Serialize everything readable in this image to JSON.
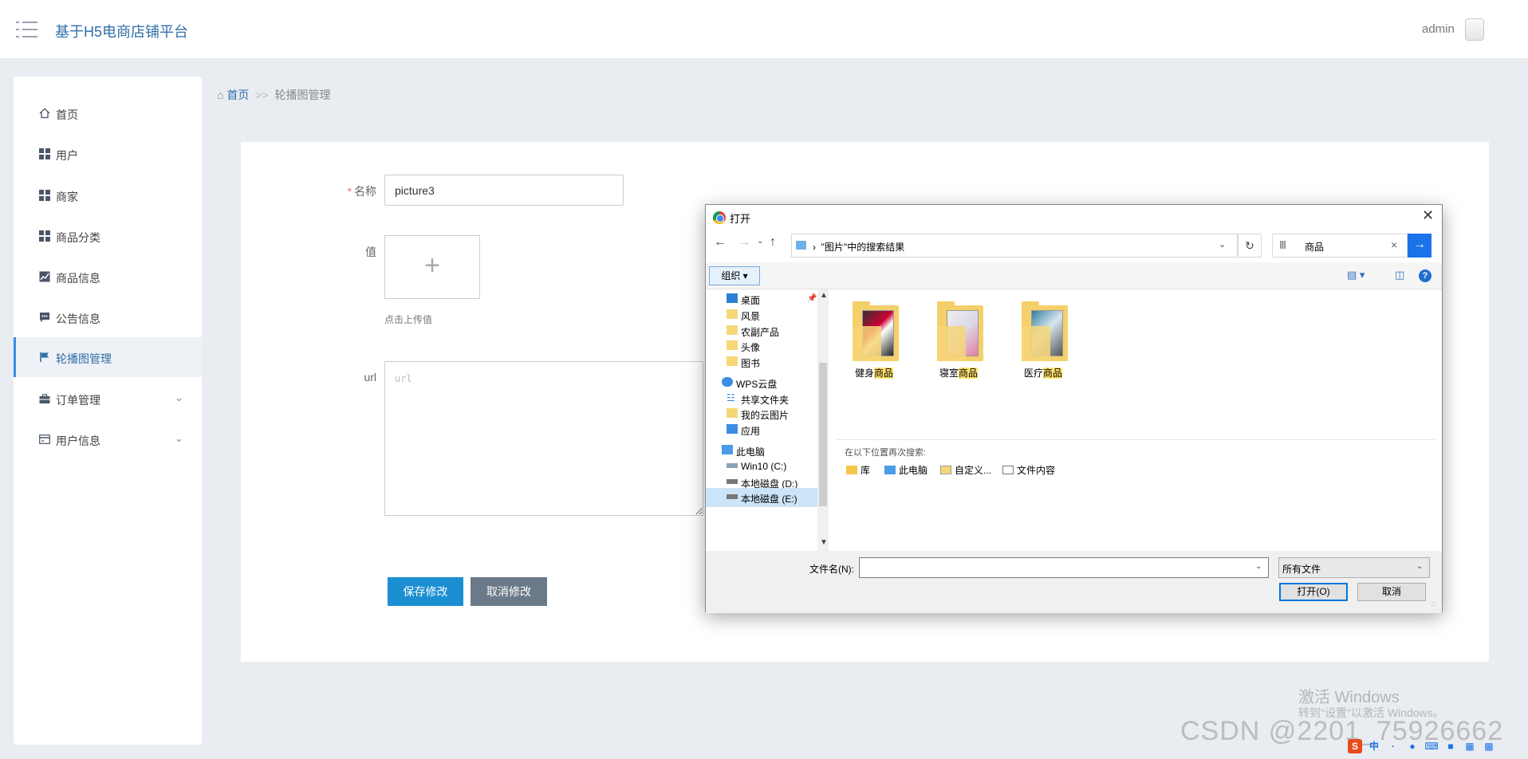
{
  "header": {
    "app_title": "基于H5电商店铺平台",
    "user_name": "admin"
  },
  "sidebar": {
    "items": [
      {
        "label": "首页"
      },
      {
        "label": "用户"
      },
      {
        "label": "商家"
      },
      {
        "label": "商品分类"
      },
      {
        "label": "商品信息"
      },
      {
        "label": "公告信息"
      },
      {
        "label": "轮播图管理",
        "active": true
      },
      {
        "label": "订单管理",
        "expandable": true
      },
      {
        "label": "用户信息",
        "expandable": true
      }
    ]
  },
  "breadcrumb": {
    "home": "首页",
    "separator": ">>",
    "current": "轮播图管理"
  },
  "form": {
    "name_label": "名称",
    "required_mark": "*",
    "name_value": "picture3",
    "value_label": "值",
    "upload_plus": "+",
    "upload_hint": "点击上传值",
    "url_label": "url",
    "url_placeholder": "url",
    "save_label": "保存修改",
    "cancel_label": "取消修改"
  },
  "watermarks": {
    "activate_title": "激活 Windows",
    "activate_sub": "转到\"设置\"以激活 Windows。",
    "csdn": "CSDN @2201_75926662"
  },
  "dialog": {
    "title": "打开",
    "address": "\"图片\"中的搜索结果",
    "search_query": "商品",
    "organize_label": "组织 ▾",
    "tree": [
      {
        "label": "桌面",
        "icon": "desktop-icon"
      },
      {
        "label": "风景",
        "icon": "folder-icon"
      },
      {
        "label": "农副产品",
        "icon": "folder-icon"
      },
      {
        "label": "头像",
        "icon": "folder-icon"
      },
      {
        "label": "图书",
        "icon": "folder-icon"
      },
      {
        "label": "WPS云盘",
        "icon": "cloud-icon"
      },
      {
        "label": "共享文件夹",
        "icon": "share-icon"
      },
      {
        "label": "我的云图片",
        "icon": "folder-icon"
      },
      {
        "label": "应用",
        "icon": "apps-icon"
      },
      {
        "label": "此电脑",
        "icon": "pc-icon"
      },
      {
        "label": "Win10 (C:)",
        "icon": "drive-icon"
      },
      {
        "label": "本地磁盘 (D:)",
        "icon": "drive-icon"
      },
      {
        "label": "本地磁盘 (E:)",
        "icon": "drive-icon"
      }
    ],
    "files": [
      {
        "prefix": "健身",
        "match": "商品"
      },
      {
        "prefix": "寝室",
        "match": "商品"
      },
      {
        "prefix": "医疗",
        "match": "商品"
      }
    ],
    "search_again_label": "在以下位置再次搜索:",
    "search_again_locations": [
      "库",
      "此电脑",
      "自定义...",
      "文件内容"
    ],
    "filename_label": "文件名(N):",
    "filename_value": "",
    "filetype_value": "所有文件",
    "open_label": "打开(O)",
    "cancel_label": "取消"
  },
  "colors": {
    "accent": "#2f6fa8",
    "save_button": "#1b8fd1",
    "cancel_button": "#6b7a88",
    "dialog_accent": "#1a73e8"
  }
}
